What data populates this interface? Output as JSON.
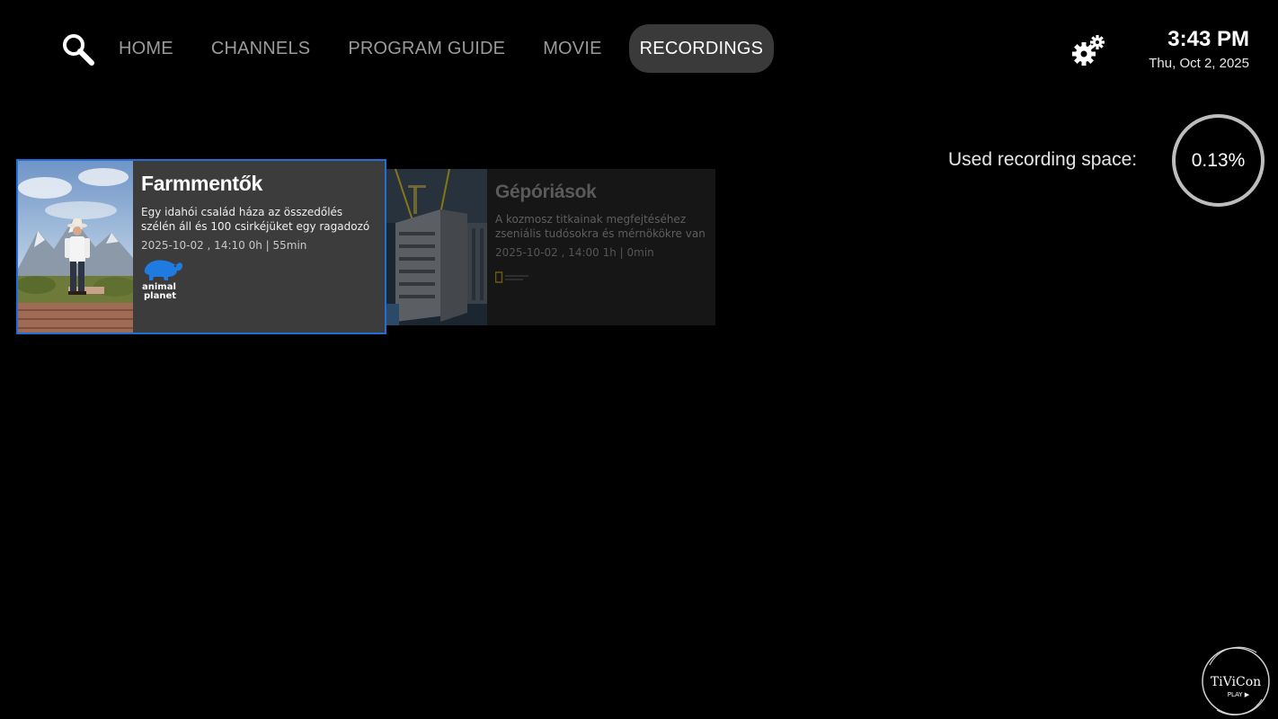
{
  "nav": {
    "items": [
      {
        "label": "HOME"
      },
      {
        "label": "CHANNELS"
      },
      {
        "label": "PROGRAM GUIDE"
      },
      {
        "label": "MOVIE"
      },
      {
        "label": "RECORDINGS"
      }
    ],
    "active": "RECORDINGS"
  },
  "icons": {
    "search": "search-icon",
    "settings": "gear-icon"
  },
  "clock": {
    "time": "3:43 PM",
    "date": "Thu, Oct 2, 2025"
  },
  "storage": {
    "label": "Used recording space:",
    "value": "0.13%"
  },
  "recordings": [
    {
      "title": "Farmmentők",
      "description": "Egy idahói család háza az összedőlés szélén áll és 100 csirkéjüket egy ragadozó fenyeget…",
      "meta": "2025-10-02 , 14:10  0h | 55min",
      "channel_logo_text": "animal planet",
      "focused": true
    },
    {
      "title": "Gépóriások",
      "description": "A kozmosz titkainak megfejtéséhez zseniális tudósokra és mérnökökre van szükség - val…",
      "meta": "2025-10-02 , 14:00  1h | 0min",
      "focused": false
    }
  ],
  "watermark": {
    "line1": "TiViCon",
    "line2": "PLAY"
  },
  "colors": {
    "background": "#000000",
    "focus_border": "#1f6fd6",
    "active_tab_bg": "#3a3a3a",
    "animal_planet_blue": "#1f7be0"
  }
}
